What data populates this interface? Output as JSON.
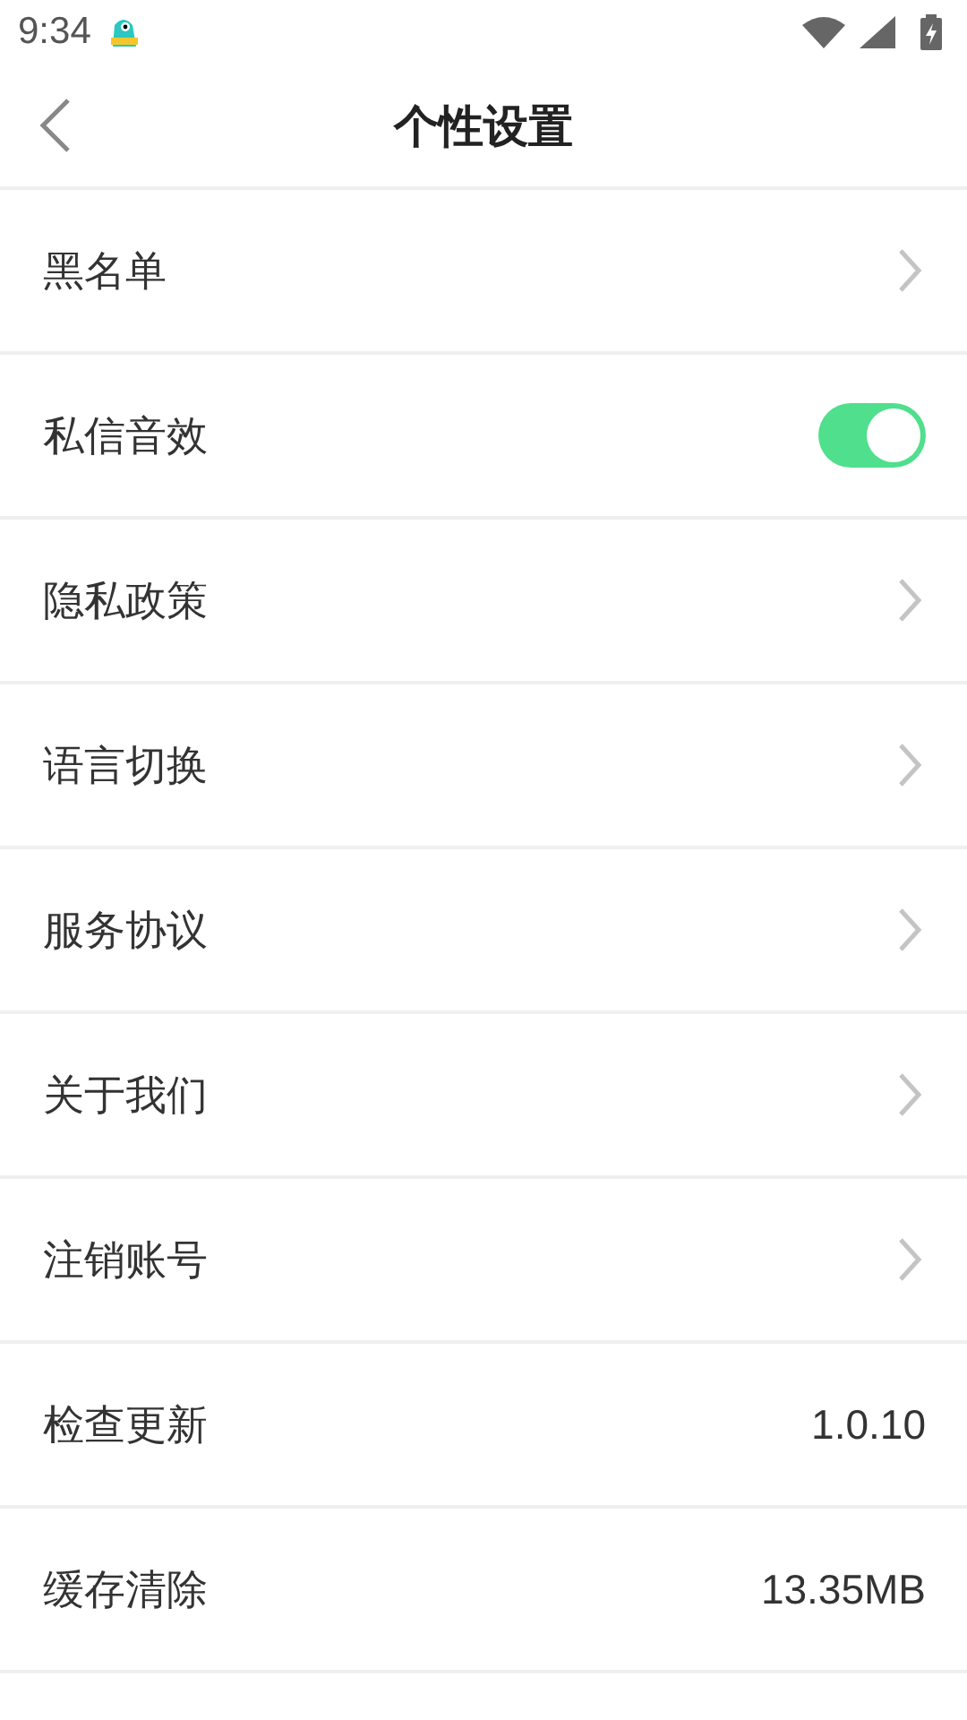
{
  "status_bar": {
    "time": "9:34"
  },
  "header": {
    "title": "个性设置"
  },
  "items": [
    {
      "kind": "link",
      "label": "黑名单"
    },
    {
      "kind": "toggle",
      "label": "私信音效",
      "on": true
    },
    {
      "kind": "link",
      "label": "隐私政策"
    },
    {
      "kind": "link",
      "label": "语言切换"
    },
    {
      "kind": "link",
      "label": "服务协议"
    },
    {
      "kind": "link",
      "label": "关于我们"
    },
    {
      "kind": "link",
      "label": "注销账号"
    },
    {
      "kind": "value",
      "label": "检查更新",
      "value": "1.0.10"
    },
    {
      "kind": "value",
      "label": "缓存清除",
      "value": "13.35MB"
    }
  ]
}
